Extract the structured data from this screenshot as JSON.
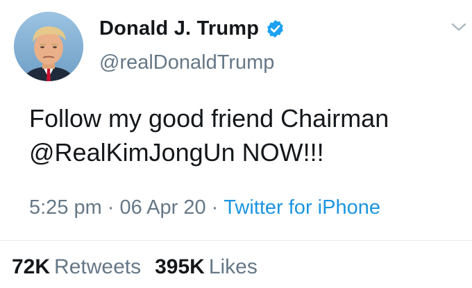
{
  "author": {
    "display_name": "Donald J. Trump",
    "handle": "@realDonaldTrump",
    "verified": true,
    "verified_icon": "verified-badge-icon",
    "verified_color": "#1da1f2"
  },
  "tweet": {
    "text_lines": [
      "Follow my good friend Chairman",
      "@RealKimJongUn NOW!!!"
    ]
  },
  "meta": {
    "time": "5:25 pm",
    "separator": "·",
    "date": "06 Apr 20",
    "source": "Twitter for iPhone",
    "source_color": "#1b95e0"
  },
  "stats": {
    "retweets_count": "72K",
    "retweets_label": "Retweets",
    "likes_count": "395K",
    "likes_label": "Likes"
  },
  "menu_icon": "chevron-down-icon"
}
